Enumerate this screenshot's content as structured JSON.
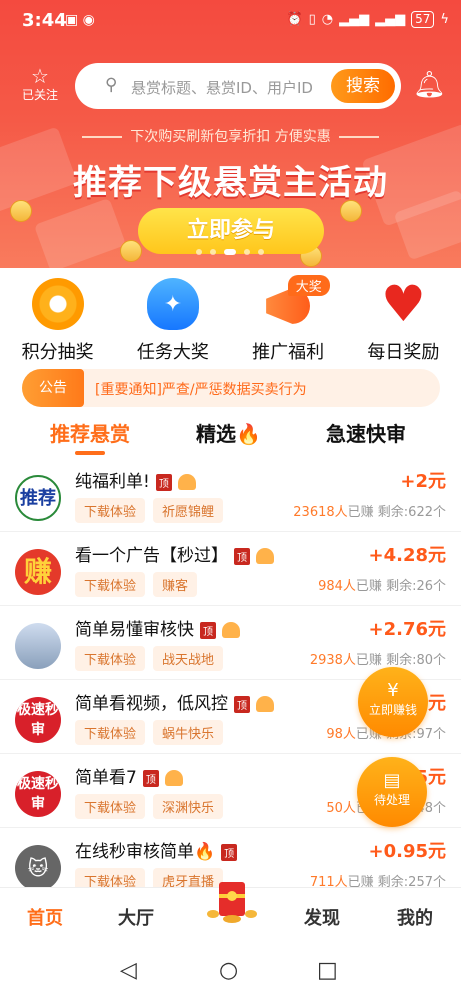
{
  "status": {
    "time": "3:44",
    "battery": "57"
  },
  "header": {
    "follow_label": "已关注",
    "search_placeholder": "悬赏标题、悬赏ID、用户ID",
    "search_button": "搜索"
  },
  "banner": {
    "subtitle": "下次购买刷新包享折扣 方便实惠",
    "title": "推荐下级悬赏主活动",
    "join_button": "立即参与"
  },
  "quick": [
    {
      "label": "积分抽奖"
    },
    {
      "label": "任务大奖",
      "badge": ""
    },
    {
      "label": "推广福利",
      "badge": "大奖"
    },
    {
      "label": "每日奖励"
    }
  ],
  "notice": {
    "tag": "公告",
    "text": "[重要通知]严查/严惩数据买卖行为"
  },
  "tabs": [
    {
      "label": "推荐悬赏"
    },
    {
      "label": "精选🔥"
    },
    {
      "label": "急速快审"
    }
  ],
  "tasks": [
    {
      "title": "纯福利单!",
      "tags": [
        "下载体验",
        "祈愿锦鲤"
      ],
      "reward": "+2元",
      "count": "23618人",
      "earned": "已赚",
      "remain": "剩余:622个",
      "avatar_text": "推荐"
    },
    {
      "title": "看一个广告【秒过】",
      "tags": [
        "下载体验",
        "赚客"
      ],
      "reward": "+4.28元",
      "count": "984人",
      "earned": "已赚",
      "remain": "剩余:26个",
      "avatar_text": "赚"
    },
    {
      "title": "简单易懂审核快",
      "tags": [
        "下载体验",
        "战天战地"
      ],
      "reward": "+2.76元",
      "count": "2938人",
      "earned": "已赚",
      "remain": "剩余:80个",
      "avatar_text": ""
    },
    {
      "title": "简单看视频，低风控",
      "tags": [
        "下载体验",
        "蜗牛快乐"
      ],
      "reward": "+1.4元",
      "count": "98人",
      "earned": "已赚",
      "remain": "剩余:97个",
      "avatar_text": "极速秒审"
    },
    {
      "title": "简单看7",
      "tags": [
        "下载体验",
        "深渊快乐"
      ],
      "reward": "+1.5元",
      "count": "50人",
      "earned": "已赚",
      "remain": "剩余:48个",
      "avatar_text": "极速秒审"
    },
    {
      "title": "在线秒审核简单🔥",
      "tags": [
        "下载体验",
        "虎牙直播"
      ],
      "reward": "+0.95元",
      "count": "711人",
      "earned": "已赚",
      "remain": "剩余:257个",
      "avatar_text": "🐱"
    }
  ],
  "pin_label": "顶",
  "float_buttons": {
    "earn": "立即赚钱",
    "pending": "待处理"
  },
  "bottom_nav": [
    {
      "label": "首页"
    },
    {
      "label": "大厅"
    },
    {
      "label": "发现"
    },
    {
      "label": "我的"
    }
  ],
  "colors": {
    "primary": "#ff6e1a",
    "hero": "#f44a3f"
  }
}
